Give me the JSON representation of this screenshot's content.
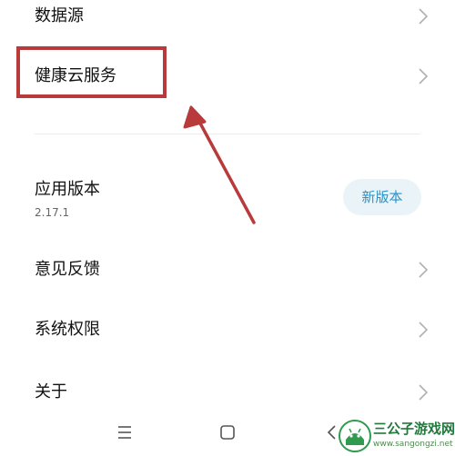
{
  "settings": {
    "data_source_label": "数据源",
    "health_cloud_label": "健康云服务",
    "app_version_label": "应用版本",
    "app_version_value": "2.17.1",
    "new_version_button": "新版本",
    "feedback_label": "意见反馈",
    "permissions_label": "系统权限",
    "about_label": "关于"
  },
  "annotation": {
    "highlight_color": "#b83a3a"
  },
  "navbar": {
    "icons": [
      "menu-icon",
      "home-icon",
      "back-icon"
    ]
  },
  "watermark": {
    "title": "三公子游戏网",
    "url": "www.sangongzi.net"
  }
}
